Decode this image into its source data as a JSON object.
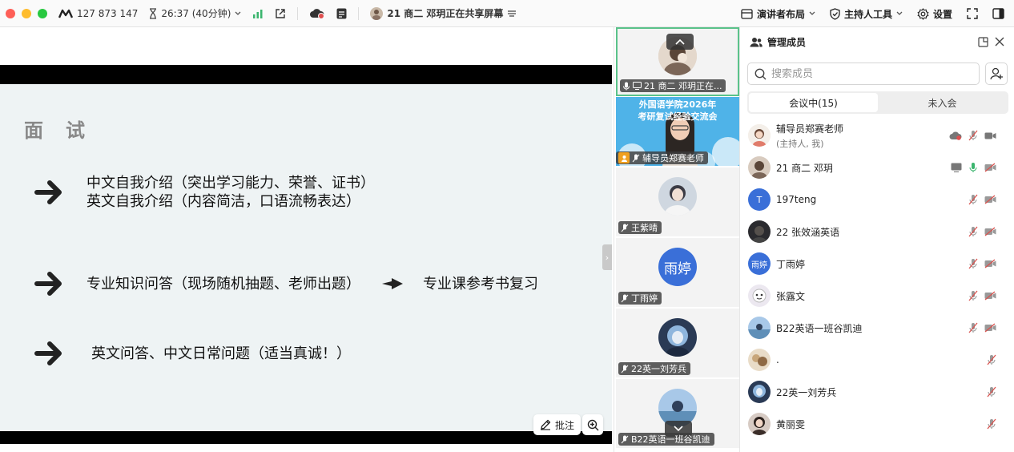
{
  "topbar": {
    "meeting_id": "127 873 147",
    "timer": "26:37 (40分钟)",
    "sharing_text": "21 商二 邓玥正在共享屏幕",
    "layout_label": "演讲者布局",
    "host_tools_label": "主持人工具",
    "settings_label": "设置"
  },
  "slide": {
    "title": "面试",
    "bullet1_line1": "中文自我介绍（突出学习能力、荣誉、证书）",
    "bullet1_line2": "英文自我介绍（内容简洁，口语流畅表达）",
    "bullet2": "专业知识问答（现场随机抽题、老师出题）",
    "bullet2_extra": "专业课参考书复习",
    "bullet3": "英文问答、中文日常问题（适当真诚！）"
  },
  "share_tools": {
    "annotate_label": "批注"
  },
  "strip": {
    "tiles": [
      {
        "label": "21 商二 邓玥正在..."
      },
      {
        "label": "辅导员郑赛老师",
        "banner_line1": "外国语学院2026年",
        "banner_line2": "考研复试经验交流会"
      },
      {
        "label": "王紫晴"
      },
      {
        "label": "丁雨婷",
        "avatar_text": "雨婷"
      },
      {
        "label": "22英一刘芳兵"
      },
      {
        "label": "B22英语一班谷凯迪"
      }
    ]
  },
  "panel": {
    "title": "管理成员",
    "search_placeholder": "搜索成员",
    "tab_in": "会议中(15)",
    "tab_out": "未入会",
    "members": [
      {
        "name": "辅导员郑赛老师",
        "sub": "(主持人, 我)"
      },
      {
        "name": "21 商二 邓玥"
      },
      {
        "name": "197teng",
        "avatar_text": "T"
      },
      {
        "name": "22 张效涵英语"
      },
      {
        "name": "丁雨婷",
        "avatar_text": "雨婷"
      },
      {
        "name": "张露文"
      },
      {
        "name": "B22英语一班谷凯迪"
      },
      {
        "name": "."
      },
      {
        "name": "22英一刘芳兵"
      },
      {
        "name": "黄丽雯"
      }
    ]
  },
  "colors": {
    "accent_blue": "#3a6fd8",
    "active_green": "#5ac28a",
    "mic_off_red": "#d9534f"
  }
}
